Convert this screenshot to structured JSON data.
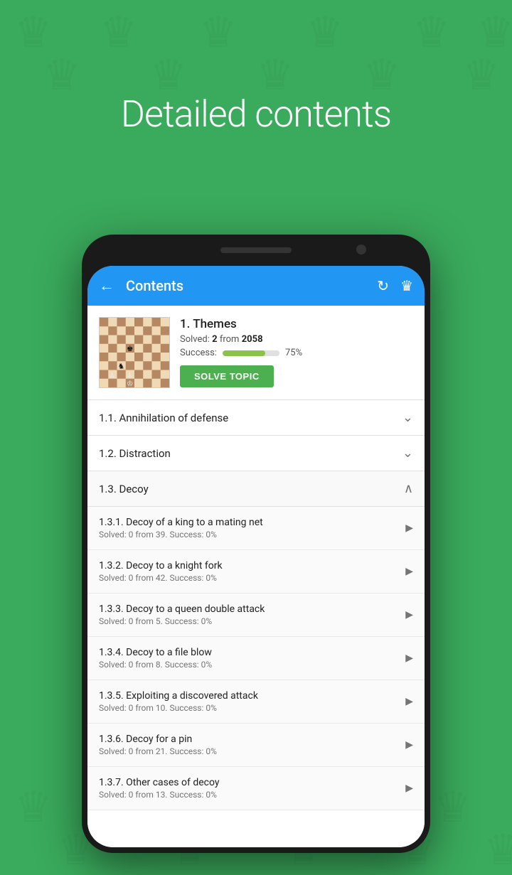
{
  "page": {
    "bg_color": "#3aaa5c",
    "title": "Detailed contents"
  },
  "app_bar": {
    "back_label": "←",
    "title": "Contents",
    "icon_refresh": "↻",
    "icon_app": "♛"
  },
  "topic_header": {
    "title": "1. Themes",
    "solved_label": "Solved:",
    "solved_count": "2",
    "solved_from": "from",
    "solved_total": "2058",
    "success_label": "Success:",
    "success_pct": "75%",
    "progress_fill_pct": 75,
    "solve_btn_label": "SOLVE TOPIC"
  },
  "list_items": [
    {
      "id": "1.1",
      "title": "1.1. Annihilation of defense",
      "subtitle": "",
      "type": "collapsed",
      "subitems": []
    },
    {
      "id": "1.2",
      "title": "1.2. Distraction",
      "subtitle": "",
      "type": "collapsed",
      "subitems": []
    },
    {
      "id": "1.3",
      "title": "1.3. Decoy",
      "subtitle": "",
      "type": "expanded",
      "subitems": [
        {
          "title": "1.3.1. Decoy of a king to a mating net",
          "subtitle": "Solved: 0 from 39. Success: 0%"
        },
        {
          "title": "1.3.2. Decoy to a knight fork",
          "subtitle": "Solved: 0 from 42. Success: 0%"
        },
        {
          "title": "1.3.3. Decoy to a queen double attack",
          "subtitle": "Solved: 0 from 5. Success: 0%"
        },
        {
          "title": "1.3.4. Decoy to a file blow",
          "subtitle": "Solved: 0 from 8. Success: 0%"
        },
        {
          "title": "1.3.5. Exploiting a discovered attack",
          "subtitle": "Solved: 0 from 10. Success: 0%"
        },
        {
          "title": "1.3.6. Decoy for a pin",
          "subtitle": "Solved: 0 from 21. Success: 0%"
        },
        {
          "title": "1.3.7. Other cases of decoy",
          "subtitle": "Solved: 0 from 13. Success: 0%"
        }
      ]
    }
  ]
}
